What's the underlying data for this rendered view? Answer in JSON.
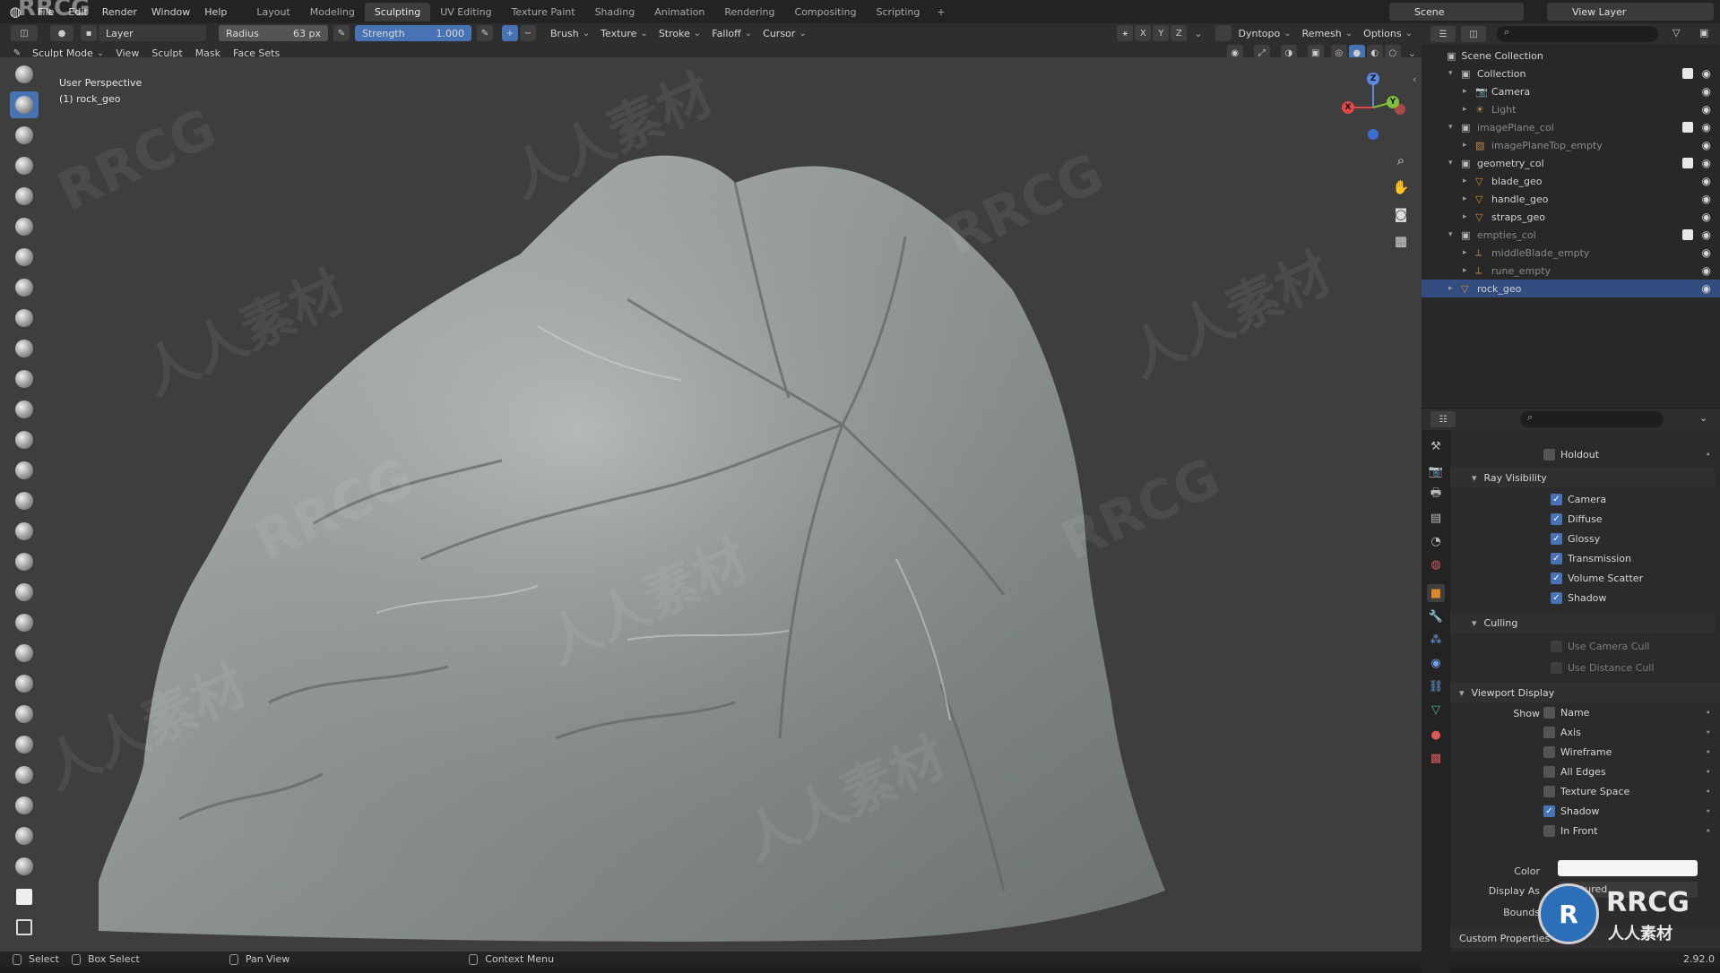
{
  "watermark_top": "RRCG",
  "menu": [
    "File",
    "Edit",
    "Render",
    "Window",
    "Help"
  ],
  "workspace_tabs": [
    "Layout",
    "Modeling",
    "Sculpting",
    "UV Editing",
    "Texture Paint",
    "Shading",
    "Animation",
    "Rendering",
    "Compositing",
    "Scripting"
  ],
  "active_tab": "Sculpting",
  "scene": "Scene",
  "view_layer": "View Layer",
  "toolbar": {
    "brush_name": "Layer",
    "radius_label": "Radius",
    "radius_value": "63 px",
    "strength_label": "Strength",
    "strength_value": "1.000",
    "dropdowns": [
      "Brush",
      "Texture",
      "Stroke",
      "Falloff",
      "Cursor"
    ],
    "axes": [
      "X",
      "Y",
      "Z"
    ],
    "right_dropdowns": [
      "Dyntopo",
      "Remesh",
      "Options"
    ]
  },
  "mode_row": {
    "mode": "Sculpt Mode",
    "menus": [
      "View",
      "Sculpt",
      "Mask",
      "Face Sets"
    ]
  },
  "viewport": {
    "perspective": "User Perspective",
    "object": "(1) rock_geo",
    "gizmo": {
      "x": "X",
      "y": "Y",
      "z": "Z"
    }
  },
  "outliner": {
    "root": "Scene Collection",
    "rows": [
      {
        "label": "Collection",
        "indent": 1,
        "type": "collection",
        "check": true
      },
      {
        "label": "Camera",
        "indent": 2,
        "type": "camera"
      },
      {
        "label": "Light",
        "indent": 2,
        "type": "light",
        "dim": true
      },
      {
        "label": "imagePlane_col",
        "indent": 1,
        "type": "collection",
        "dim": true,
        "check": true
      },
      {
        "label": "imagePlaneTop_empty",
        "indent": 2,
        "type": "image",
        "dim": true
      },
      {
        "label": "geometry_col",
        "indent": 1,
        "type": "collection",
        "check": true
      },
      {
        "label": "blade_geo",
        "indent": 2,
        "type": "mesh"
      },
      {
        "label": "handle_geo",
        "indent": 2,
        "type": "mesh"
      },
      {
        "label": "straps_geo",
        "indent": 2,
        "type": "mesh"
      },
      {
        "label": "empties_col",
        "indent": 1,
        "type": "collection",
        "dim": true,
        "check": true
      },
      {
        "label": "middleBlade_empty",
        "indent": 2,
        "type": "empty",
        "dim": true
      },
      {
        "label": "rune_empty",
        "indent": 2,
        "type": "empty",
        "dim": true
      },
      {
        "label": "rock_geo",
        "indent": 1,
        "type": "mesh",
        "selected": true
      }
    ]
  },
  "properties": {
    "holdout": "Holdout",
    "ray_visibility": {
      "title": "Ray Visibility",
      "items": [
        "Camera",
        "Diffuse",
        "Glossy",
        "Transmission",
        "Volume Scatter",
        "Shadow"
      ]
    },
    "culling": {
      "title": "Culling",
      "items": [
        "Use Camera Cull",
        "Use Distance Cull"
      ]
    },
    "viewport_display": {
      "title": "Viewport Display",
      "show_label": "Show",
      "items": [
        {
          "label": "Name",
          "on": false
        },
        {
          "label": "Axis",
          "on": false
        },
        {
          "label": "Wireframe",
          "on": false
        },
        {
          "label": "All Edges",
          "on": false
        },
        {
          "label": "Texture Space",
          "on": false
        },
        {
          "label": "Shadow",
          "on": true
        },
        {
          "label": "In Front",
          "on": false
        }
      ],
      "color_label": "Color",
      "display_as_label": "Display As",
      "display_as_value": "Textured",
      "bounds_label": "Bounds"
    },
    "custom_properties": "Custom Properties"
  },
  "statusbar": {
    "items": [
      "Select",
      "Box Select",
      "Pan View",
      "Context Menu"
    ],
    "version": "2.92.0"
  },
  "brand": {
    "logo": "RRCG",
    "sub": "人人素材"
  },
  "colors": {
    "accent": "#4772b3",
    "selected_row": "#334d80",
    "mesh_icon": "#e0862a",
    "viewport": "#3e3e3e"
  }
}
